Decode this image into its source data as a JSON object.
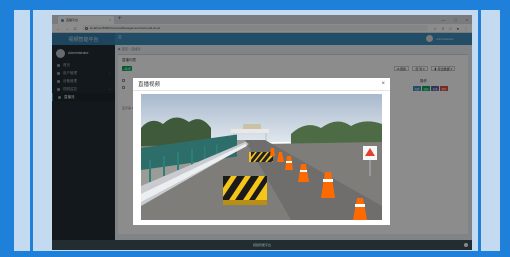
{
  "browser": {
    "tab_title": "直播平台",
    "tab_close": "×",
    "new_tab": "+",
    "window_controls": [
      "—",
      "□",
      "×"
    ],
    "back": "←",
    "forward": "→",
    "reload": "C",
    "url": "localhost:8080/Camera/Management/Camera/List.jsf",
    "addr_icons": [
      "☆",
      "≡",
      "□",
      "●",
      "⋮"
    ]
  },
  "app": {
    "logo": "视频智能平台",
    "menu_toggle": "≡",
    "user_name": "Administrator",
    "sidebar": [
      {
        "label": "首页"
      },
      {
        "label": "用户管理"
      },
      {
        "label": "设备管理"
      },
      {
        "label": "视频监控"
      },
      {
        "label": "直播流"
      }
    ],
    "breadcrumb": "▶ 首页 > 直播流",
    "card_title": "直播列表",
    "add_button": "+新增",
    "toolbar": [
      "⊞ 刷新",
      "▦ 列 ▾",
      "⬇ 导出数据 ▾"
    ],
    "column_header": "操作",
    "row_actions": [
      "查看",
      "编辑",
      "直播",
      "删除"
    ],
    "pager_text": "显示第 1 到第 2 条记录",
    "footer": "视频智能平台"
  },
  "modal": {
    "title": "直播视频",
    "close": "×"
  },
  "colors": {
    "accent": "#3c8dbc",
    "sidebar": "#222d32",
    "success": "#00a65a",
    "danger": "#dd4b39"
  }
}
